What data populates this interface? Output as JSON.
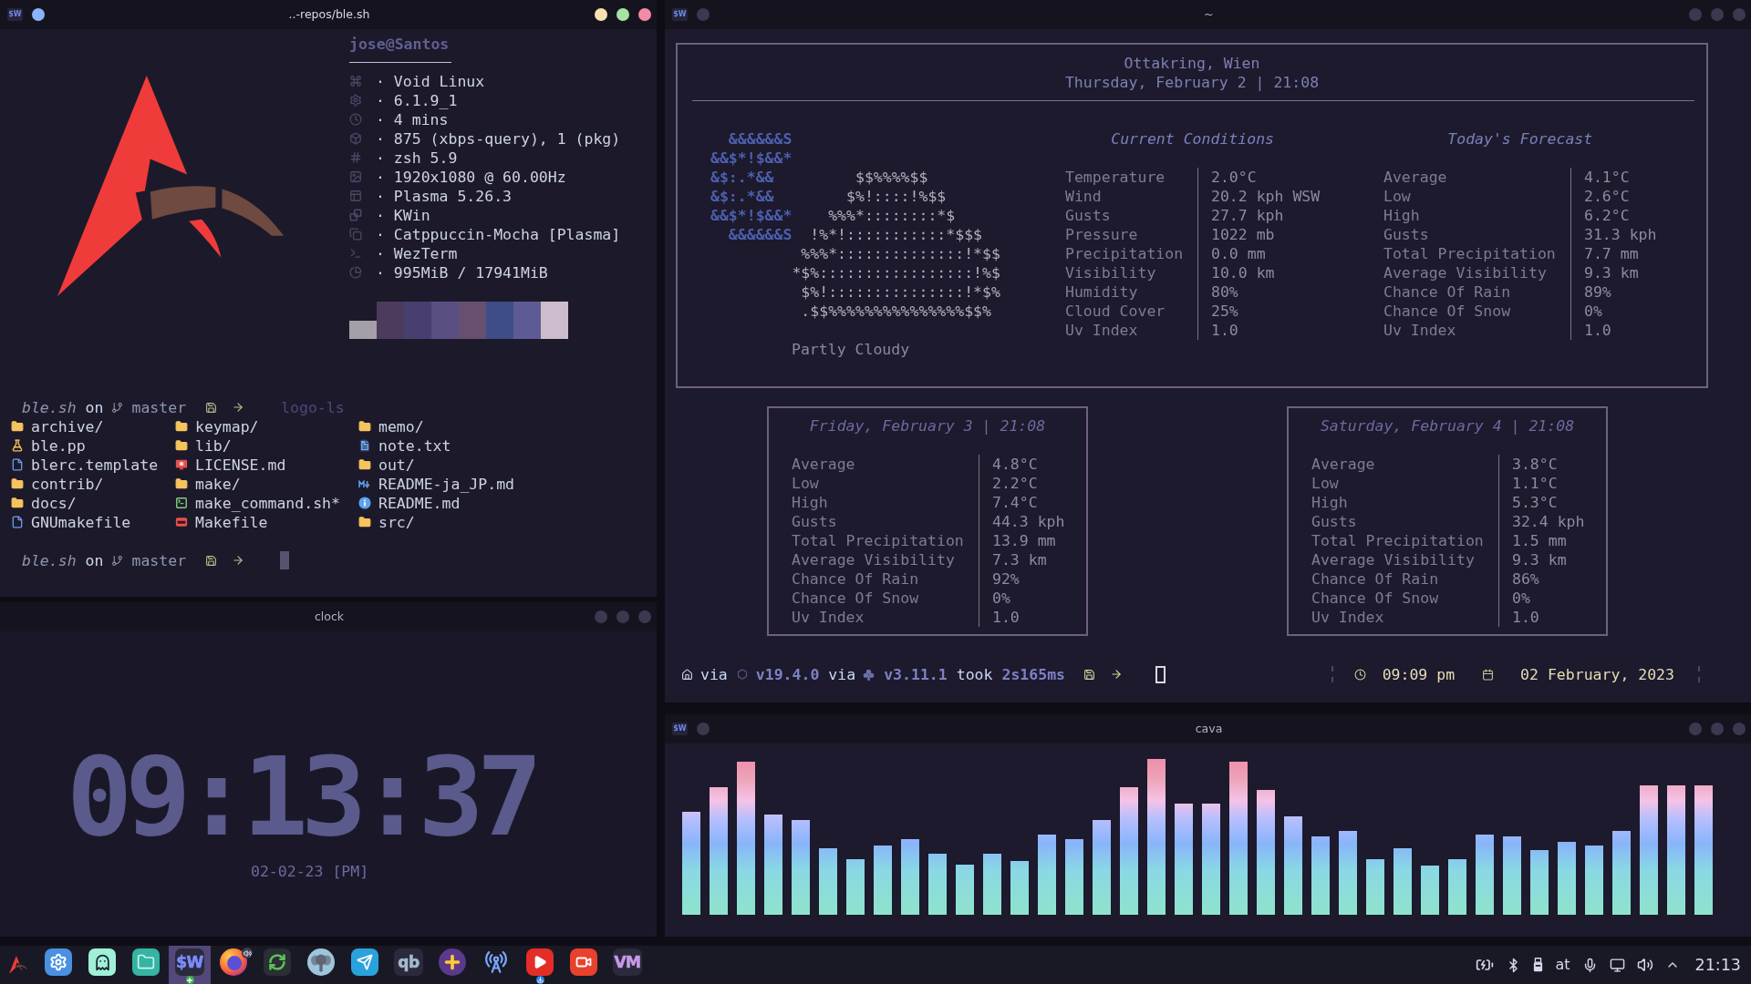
{
  "terminal": {
    "window": {
      "title": "..-repos/ble.sh",
      "app_icon": "$W",
      "active": true
    },
    "fetch": {
      "title": "jose@Santos",
      "info": [
        {
          "kind": "os",
          "text": "· Void Linux"
        },
        {
          "kind": "kernel",
          "text": "· 6.1.9_1"
        },
        {
          "kind": "uptime",
          "text": "· 4 mins"
        },
        {
          "kind": "packages",
          "text": "· 875 (xbps-query), 1 (pkg)"
        },
        {
          "kind": "shell",
          "text": "· zsh 5.9"
        },
        {
          "kind": "resolution",
          "text": "· 1920x1080 @ 60.00Hz"
        },
        {
          "kind": "de",
          "text": "· Plasma 5.26.3"
        },
        {
          "kind": "wm",
          "text": "· KWin"
        },
        {
          "kind": "theme",
          "text": "· Catppuccin-Mocha [Plasma]"
        },
        {
          "kind": "terminal",
          "text": "· WezTerm"
        },
        {
          "kind": "memory",
          "text": "· 995MiB / 17941MiB"
        }
      ],
      "palette": [
        [
          {
            "color": "#4b3b5c"
          },
          {
            "color": "#483e70"
          },
          {
            "color": "#5a4f83"
          },
          {
            "color": "#67506f"
          },
          {
            "color": "#3e4d87"
          },
          {
            "color": "#5e5b94"
          },
          {
            "color": "#cdbccb"
          }
        ],
        [
          {
            "color": "#a59fa9"
          },
          {
            "color": "#4b3b5c"
          },
          {
            "color": "#483e70"
          },
          {
            "color": "#5a4f83"
          },
          {
            "color": "#67506f"
          },
          {
            "color": "#3e4d87"
          },
          {
            "color": "#5e5b94"
          },
          {
            "color": "#cdbccb"
          }
        ]
      ]
    },
    "prompts": [
      {
        "directory": "ble.sh",
        "on": "on",
        "branch": "master",
        "command": "logo-ls"
      },
      {
        "directory": "ble.sh",
        "on": "on",
        "branch": "master",
        "cursor": true
      }
    ],
    "listing": [
      [
        {
          "kind": "folder",
          "name": "archive/"
        },
        {
          "kind": "flask",
          "name": "ble.pp"
        },
        {
          "kind": "file",
          "name": "blerc.template"
        },
        {
          "kind": "folder",
          "name": "contrib/"
        },
        {
          "kind": "folder",
          "name": "docs/"
        },
        {
          "kind": "file",
          "name": "GNUmakefile"
        }
      ],
      [
        {
          "kind": "folder",
          "name": "keymap/"
        },
        {
          "kind": "folder",
          "name": "lib/"
        },
        {
          "kind": "certificate",
          "name": "LICENSE.md"
        },
        {
          "kind": "folder",
          "name": "make/"
        },
        {
          "kind": "script",
          "name": "make_command.sh*"
        },
        {
          "kind": "makefile",
          "name": "Makefile"
        }
      ],
      [
        {
          "kind": "folder",
          "name": "memo/"
        },
        {
          "kind": "text",
          "name": "note.txt"
        },
        {
          "kind": "folder",
          "name": "out/"
        },
        {
          "kind": "markdown",
          "name": "README-ja_JP.md"
        },
        {
          "kind": "info",
          "name": "README.md"
        },
        {
          "kind": "folder",
          "name": "src/"
        }
      ]
    ]
  },
  "weather": {
    "window": {
      "title": "~",
      "app_icon": "$W",
      "active": false
    },
    "location": "Ottakring, Wien",
    "date_time": "Thursday, February 2 | 21:08",
    "art": [
      {
        "moon": "  &&&&&&S"
      },
      {
        "moon": "&&$*!$&&*"
      },
      {
        "moon": "&$:.*&&",
        "cloud": "         $$%%%%$$"
      },
      {
        "moon": "&$:.*&&",
        "cloud": "        $%!::::!%$$"
      },
      {
        "moon": "&&$*!$&&*",
        "cloud": "    %%%*::::::::*$"
      },
      {
        "moon": "  &&&&&&S",
        "cloud": "  !%*!:::::::::::*$$$"
      },
      {
        "cloud": "          %%%*::::::::::::::!*$$"
      },
      {
        "cloud": "         *$%:::::::::::::::::!%$"
      },
      {
        "cloud": "          $%!:::::::::::::::!*$%"
      },
      {
        "cloud": "          .$$%%%%%%%%%%%%%%%$$%"
      }
    ],
    "condition": "Partly Cloudy",
    "sections": [
      {
        "heading": "Current Conditions",
        "rows": [
          {
            "label": "Temperature",
            "value": "2.0°C"
          },
          {
            "label": "Wind",
            "value": "20.2 kph WSW"
          },
          {
            "label": "Gusts",
            "value": "27.7 kph"
          },
          {
            "label": "Pressure",
            "value": "1022 mb"
          },
          {
            "label": "Precipitation",
            "value": "0.0 mm"
          },
          {
            "label": "Visibility",
            "value": "10.0 km"
          },
          {
            "label": "Humidity",
            "value": "80%"
          },
          {
            "label": "Cloud Cover",
            "value": "25%"
          },
          {
            "label": "Uv Index",
            "value": "1.0"
          }
        ]
      },
      {
        "heading": "Today's Forecast",
        "rows": [
          {
            "label": "Average",
            "value": "4.1°C"
          },
          {
            "label": "Low",
            "value": "2.6°C"
          },
          {
            "label": "High",
            "value": "6.2°C"
          },
          {
            "label": "Gusts",
            "value": "31.3 kph"
          },
          {
            "label": "Total Precipitation",
            "value": "7.7 mm"
          },
          {
            "label": "Average Visibility",
            "value": "9.3 km"
          },
          {
            "label": "Chance Of Rain",
            "value": "89%"
          },
          {
            "label": "Chance Of Snow",
            "value": "0%"
          },
          {
            "label": "Uv Index",
            "value": "1.0"
          }
        ]
      }
    ],
    "days": [
      {
        "title": "Friday, February 3 | 21:08",
        "rows": [
          {
            "label": "Average",
            "value": "4.8°C"
          },
          {
            "label": "Low",
            "value": "2.2°C"
          },
          {
            "label": "High",
            "value": "7.4°C"
          },
          {
            "label": "Gusts",
            "value": "44.3 kph"
          },
          {
            "label": "Total Precipitation",
            "value": "13.9 mm"
          },
          {
            "label": "Average Visibility",
            "value": "7.3 km"
          },
          {
            "label": "Chance Of Rain",
            "value": "92%"
          },
          {
            "label": "Chance Of Snow",
            "value": "0%"
          },
          {
            "label": "Uv Index",
            "value": "1.0"
          }
        ]
      },
      {
        "title": "Saturday, February 4 | 21:08",
        "rows": [
          {
            "label": "Average",
            "value": "3.8°C"
          },
          {
            "label": "Low",
            "value": "1.1°C"
          },
          {
            "label": "High",
            "value": "5.3°C"
          },
          {
            "label": "Gusts",
            "value": "32.4 kph"
          },
          {
            "label": "Total Precipitation",
            "value": "1.5 mm"
          },
          {
            "label": "Average Visibility",
            "value": "9.3 km"
          },
          {
            "label": "Chance Of Rain",
            "value": "86%"
          },
          {
            "label": "Chance Of Snow",
            "value": "0%"
          },
          {
            "label": "Uv Index",
            "value": "1.0"
          }
        ]
      }
    ],
    "prompt": {
      "via_1": "via",
      "version_1": "v19.4.0",
      "via_2": "via",
      "version_2": "v3.11.1",
      "took": "took",
      "duration": "2s165ms",
      "cursor": true,
      "time": "09:09 pm",
      "date": "02 February, 2023"
    }
  },
  "clock": {
    "window": {
      "title": "clock",
      "active": false
    },
    "time": "09:13:37",
    "date": "02-02-23 [PM]"
  },
  "visualizer": {
    "window": {
      "title": "cava",
      "app_icon": "$W",
      "active": false
    }
  },
  "taskbar": {
    "apps": [
      {
        "kind": "gear",
        "selected": false
      },
      {
        "kind": "ghost",
        "selected": false
      },
      {
        "kind": "folder",
        "selected": false
      },
      {
        "kind": "letters",
        "text": "$W",
        "color": "#7b8cff",
        "badge": {
          "kind": "plus"
        },
        "selected": true
      },
      {
        "kind": "globe",
        "badge": {
          "kind": "speaker"
        },
        "selected": false
      },
      {
        "kind": "arrows",
        "selected": false
      },
      {
        "kind": "elephant",
        "selected": false
      },
      {
        "kind": "plane",
        "selected": false
      },
      {
        "kind": "letters",
        "text": "qb",
        "color": "#a3bad0",
        "selected": false
      },
      {
        "kind": "cross",
        "selected": false
      },
      {
        "kind": "tower",
        "selected": false
      },
      {
        "kind": "play",
        "badge": {
          "kind": "download"
        },
        "selected": false
      },
      {
        "kind": "camera",
        "selected": false
      },
      {
        "kind": "letters",
        "text": "VM",
        "color": "#c79ae8",
        "selected": false
      }
    ],
    "tray": {
      "layout": "at",
      "time": "21:13"
    }
  }
}
